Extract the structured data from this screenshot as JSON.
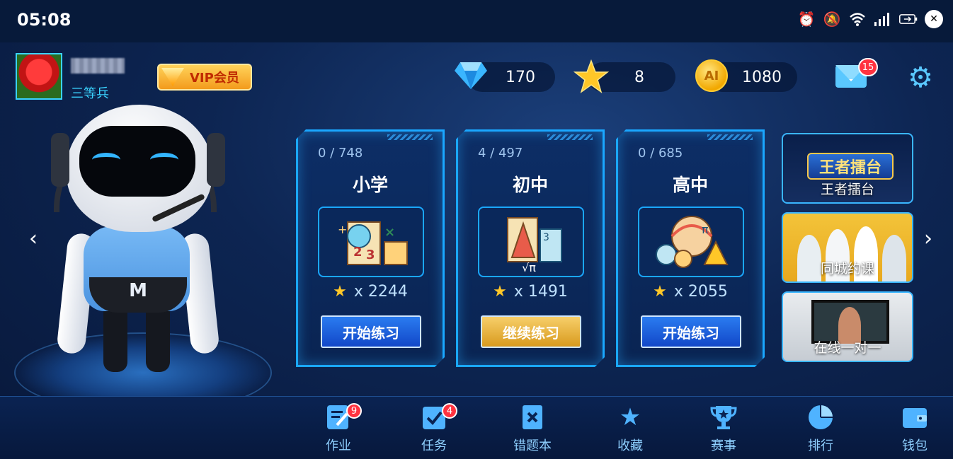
{
  "status_bar": {
    "time": "05:08"
  },
  "user": {
    "name": "",
    "rank": "三等兵",
    "vip_label": "VIP会员"
  },
  "resources": {
    "diamonds": "170",
    "stars": "8",
    "coins": "1080",
    "coin_icon_text": "AI"
  },
  "mail": {
    "badge": "15"
  },
  "cards": [
    {
      "progress": "0 / 748",
      "title": "小学",
      "stars": "x 2244",
      "button": "开始练习",
      "button_style": "blue"
    },
    {
      "progress": "4 / 497",
      "title": "初中",
      "stars": "x 1491",
      "button": "继续练习",
      "button_style": "gold"
    },
    {
      "progress": "0 / 685",
      "title": "高中",
      "stars": "x 2055",
      "button": "开始练习",
      "button_style": "blue"
    }
  ],
  "side_panels": [
    {
      "logo": "王者擂台",
      "label": "王者擂台"
    },
    {
      "label": "同城约课"
    },
    {
      "label": "在线一对一"
    }
  ],
  "bottom_nav": [
    {
      "label": "作业",
      "badge": "9",
      "icon": "homework-icon"
    },
    {
      "label": "任务",
      "badge": "4",
      "icon": "task-icon"
    },
    {
      "label": "错题本",
      "icon": "wrong-book-icon"
    },
    {
      "label": "收藏",
      "icon": "star-icon"
    },
    {
      "label": "赛事",
      "icon": "trophy-icon"
    },
    {
      "label": "排行",
      "icon": "pie-chart-icon"
    },
    {
      "label": "钱包",
      "icon": "wallet-icon"
    }
  ],
  "robot_logo": "M",
  "colors": {
    "accent": "#1aa7ff",
    "background": "#0d2552",
    "gold": "#f3c43a"
  }
}
